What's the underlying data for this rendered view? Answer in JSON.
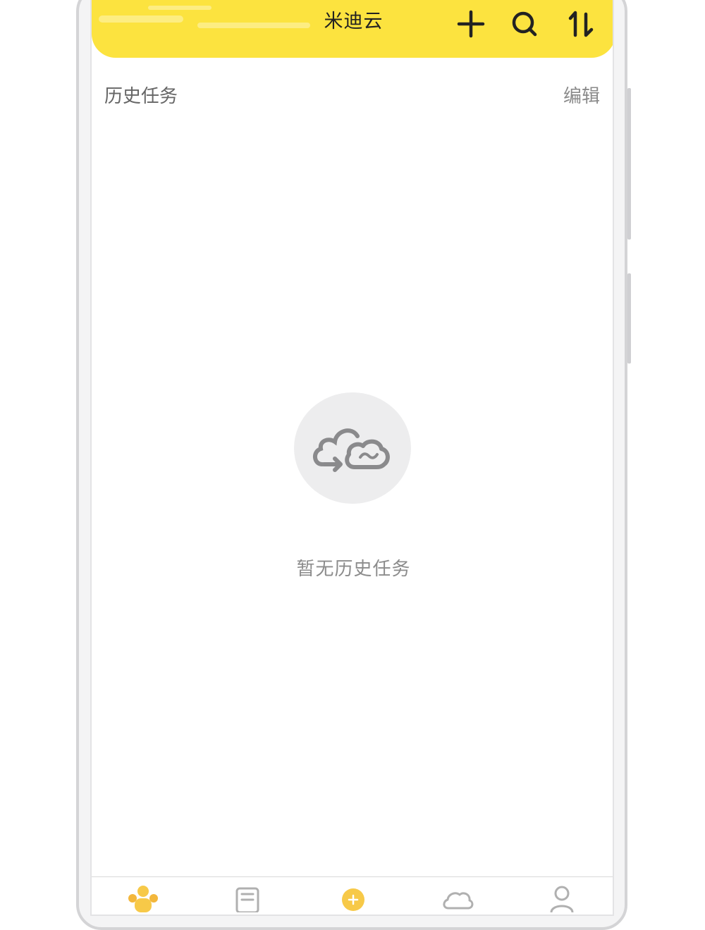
{
  "header": {
    "title": "米迪云",
    "background_color": "#fce33f",
    "icons": [
      "add-icon",
      "search-icon",
      "sort-icon"
    ]
  },
  "section": {
    "title": "历史任务",
    "edit_label": "编辑"
  },
  "empty_state": {
    "icon": "cloud-sync-icon",
    "message": "暂无历史任务"
  },
  "tab_bar": {
    "active_color": "#f7c948",
    "inactive_color": "#b0b0b0",
    "tabs": [
      {
        "icon": "people-icon",
        "active": true
      },
      {
        "icon": "document-icon",
        "active": false
      },
      {
        "icon": "plus-circle-icon",
        "active": false
      },
      {
        "icon": "cloud-icon",
        "active": false
      },
      {
        "icon": "profile-icon",
        "active": false
      }
    ]
  }
}
